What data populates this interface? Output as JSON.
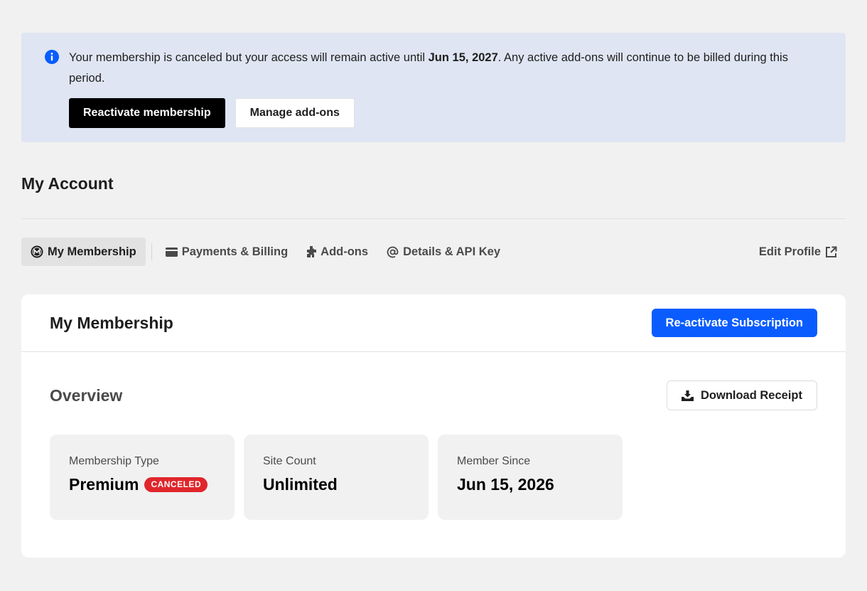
{
  "notice": {
    "message_before": "Your membership is canceled but your access will remain active until ",
    "message_date": "Jun 15, 2027",
    "message_after": ". Any active add-ons will continue to be billed during this period.",
    "reactivate_label": "Reactivate membership",
    "manage_addons_label": "Manage add-ons",
    "icon": "info-icon",
    "icon_color": "#0a5cff"
  },
  "account": {
    "title": "My Account"
  },
  "tabs": [
    {
      "label": "My Membership",
      "icon": "membership-logo-icon",
      "active": true
    },
    {
      "label": "Payments & Billing",
      "icon": "credit-card-icon",
      "active": false
    },
    {
      "label": "Add-ons",
      "icon": "puzzle-icon",
      "active": false
    },
    {
      "label": "Details & API Key",
      "icon": "at-sign-icon",
      "active": false
    }
  ],
  "edit_profile": {
    "label": "Edit Profile",
    "icon": "external-link-icon"
  },
  "membership_card": {
    "title": "My Membership",
    "reactivate_subscription_label": "Re-activate Subscription",
    "overview_title": "Overview",
    "download_receipt_label": "Download Receipt",
    "stats": [
      {
        "label": "Membership Type",
        "value": "Premium",
        "badge": "CANCELED"
      },
      {
        "label": "Site Count",
        "value": "Unlimited"
      },
      {
        "label": "Member Since",
        "value": "Jun 15, 2026"
      }
    ]
  },
  "colors": {
    "primary_blue": "#0a5cff",
    "badge_red": "#e0262b",
    "notice_bg": "#dfe5f2"
  }
}
